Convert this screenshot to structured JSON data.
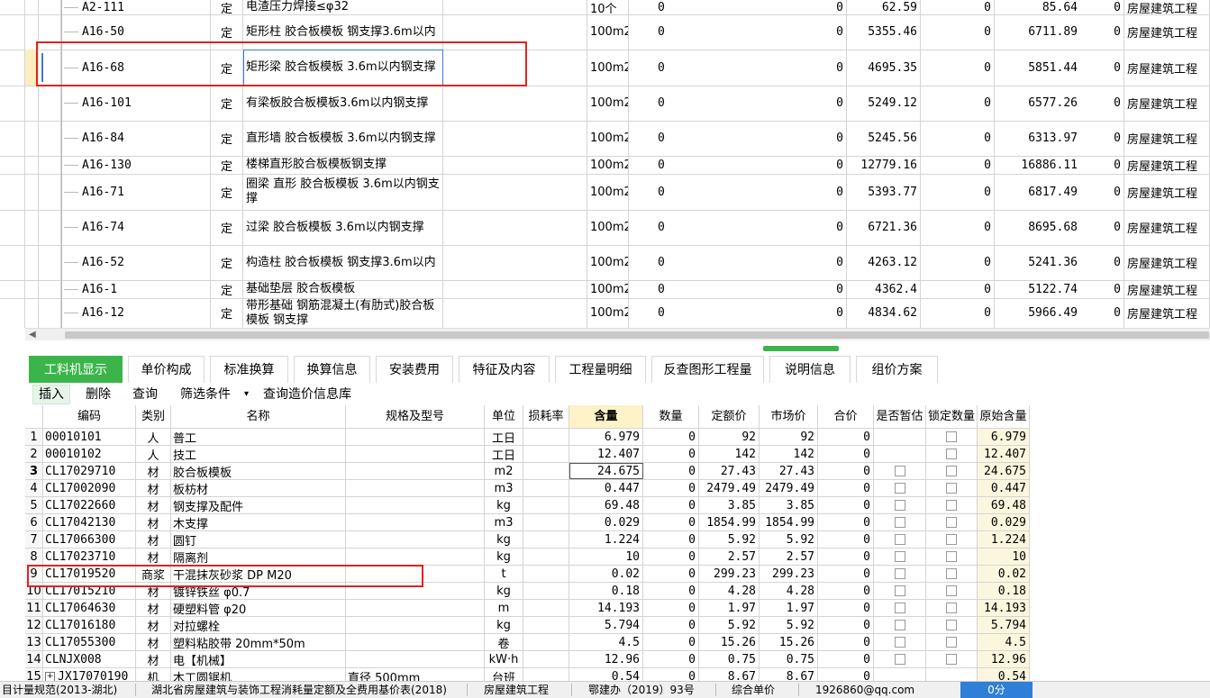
{
  "upper_rows": [
    {
      "code": "A2-111",
      "type": "定",
      "name": "电渣压力焊接≤φ32",
      "unit": "10个",
      "q": "0",
      "p1": "0",
      "v1": "62.59",
      "p2": "0",
      "v2": "85.64",
      "p3": "0",
      "cat": "房屋建筑工程"
    },
    {
      "code": "A16-50",
      "type": "定",
      "name": "矩形柱 胶合板模板 钢支撑3.6m以内",
      "unit": "100m2",
      "q": "0",
      "p1": "0",
      "v1": "5355.46",
      "p2": "0",
      "v2": "6711.89",
      "p3": "0",
      "cat": "房屋建筑工程"
    },
    {
      "code": "A16-68",
      "type": "定",
      "name": "矩形梁 胶合板模板 3.6m以内钢支撑",
      "unit": "100m2",
      "q": "0",
      "p1": "0",
      "v1": "4695.35",
      "p2": "0",
      "v2": "5851.44",
      "p3": "0",
      "cat": "房屋建筑工程"
    },
    {
      "code": "A16-101",
      "type": "定",
      "name": "有梁板胶合板模板3.6m以内钢支撑",
      "unit": "100m2",
      "q": "0",
      "p1": "0",
      "v1": "5249.12",
      "p2": "0",
      "v2": "6577.26",
      "p3": "0",
      "cat": "房屋建筑工程"
    },
    {
      "code": "A16-84",
      "type": "定",
      "name": "直形墙 胶合板模板 3.6m以内钢支撑",
      "unit": "100m2",
      "q": "0",
      "p1": "0",
      "v1": "5245.56",
      "p2": "0",
      "v2": "6313.97",
      "p3": "0",
      "cat": "房屋建筑工程"
    },
    {
      "code": "A16-130",
      "type": "定",
      "name": "楼梯直形胶合板模板钢支撑",
      "unit": "100m2",
      "q": "0",
      "p1": "0",
      "v1": "12779.16",
      "p2": "0",
      "v2": "16886.11",
      "p3": "0",
      "cat": "房屋建筑工程"
    },
    {
      "code": "A16-71",
      "type": "定",
      "name": "圈梁 直形 胶合板模板 3.6m以内钢支撑",
      "unit": "100m2",
      "q": "0",
      "p1": "0",
      "v1": "5393.77",
      "p2": "0",
      "v2": "6817.49",
      "p3": "0",
      "cat": "房屋建筑工程"
    },
    {
      "code": "A16-74",
      "type": "定",
      "name": "过梁 胶合板模板 3.6m以内钢支撑",
      "unit": "100m2",
      "q": "0",
      "p1": "0",
      "v1": "6721.36",
      "p2": "0",
      "v2": "8695.68",
      "p3": "0",
      "cat": "房屋建筑工程"
    },
    {
      "code": "A16-52",
      "type": "定",
      "name": "构造柱 胶合板模板 钢支撑3.6m以内",
      "unit": "100m2",
      "q": "0",
      "p1": "0",
      "v1": "4263.12",
      "p2": "0",
      "v2": "5241.36",
      "p3": "0",
      "cat": "房屋建筑工程"
    },
    {
      "code": "A16-1",
      "type": "定",
      "name": "基础垫层 胶合板模板",
      "unit": "100m2",
      "q": "0",
      "p1": "0",
      "v1": "4362.4",
      "p2": "0",
      "v2": "5122.74",
      "p3": "0",
      "cat": "房屋建筑工程"
    },
    {
      "code": "A16-12",
      "type": "定",
      "name": "带形基础 钢筋混凝土(有肋式)胶合板模板 钢支撑",
      "unit": "100m2",
      "q": "0",
      "p1": "0",
      "v1": "4834.62",
      "p2": "0",
      "v2": "5966.49",
      "p3": "0",
      "cat": "房屋建筑工程"
    }
  ],
  "tabs": [
    "工料机显示",
    "单价构成",
    "标准换算",
    "换算信息",
    "安装费用",
    "特征及内容",
    "工程量明细",
    "反查图形工程量",
    "说明信息",
    "组价方案"
  ],
  "toolbar": {
    "insert": "插入",
    "delete": "删除",
    "query": "查询",
    "filter": "筛选条件",
    "filter_arrow": "▾",
    "price_query": "查询造价信息库"
  },
  "lower_headers": {
    "code": "编码",
    "category": "类别",
    "name": "名称",
    "spec": "规格及型号",
    "unit": "单位",
    "loss": "损耗率",
    "content": "含量",
    "qty": "数量",
    "quota": "定额价",
    "market": "市场价",
    "total": "合价",
    "is_est": "是否暂估",
    "lock_qty": "锁定数量",
    "orig": "原始含量"
  },
  "lower_rows": [
    {
      "no": "1",
      "code": "00010101",
      "cat": "人",
      "name": "普工",
      "spec": "",
      "unit": "工日",
      "content": "6.979",
      "qty": "0",
      "quota": "92",
      "market": "92",
      "total": "0",
      "chk1": false,
      "chk2": true,
      "orig": "6.979"
    },
    {
      "no": "2",
      "code": "00010102",
      "cat": "人",
      "name": "技工",
      "spec": "",
      "unit": "工日",
      "content": "12.407",
      "qty": "0",
      "quota": "142",
      "market": "142",
      "total": "0",
      "chk1": false,
      "chk2": true,
      "orig": "12.407"
    },
    {
      "no": "3",
      "code": "CL17029710",
      "cat": "材",
      "name": "胶合板模板",
      "spec": "",
      "unit": "m2",
      "content": "24.675",
      "qty": "0",
      "quota": "27.43",
      "market": "27.43",
      "total": "0",
      "chk1": true,
      "chk2": true,
      "orig": "24.675"
    },
    {
      "no": "4",
      "code": "CL17002090",
      "cat": "材",
      "name": "板枋材",
      "spec": "",
      "unit": "m3",
      "content": "0.447",
      "qty": "0",
      "quota": "2479.49",
      "market": "2479.49",
      "total": "0",
      "chk1": true,
      "chk2": true,
      "orig": "0.447"
    },
    {
      "no": "5",
      "code": "CL17022660",
      "cat": "材",
      "name": "钢支撑及配件",
      "spec": "",
      "unit": "kg",
      "content": "69.48",
      "qty": "0",
      "quota": "3.85",
      "market": "3.85",
      "total": "0",
      "chk1": true,
      "chk2": true,
      "orig": "69.48"
    },
    {
      "no": "6",
      "code": "CL17042130",
      "cat": "材",
      "name": "木支撑",
      "spec": "",
      "unit": "m3",
      "content": "0.029",
      "qty": "0",
      "quota": "1854.99",
      "market": "1854.99",
      "total": "0",
      "chk1": true,
      "chk2": true,
      "orig": "0.029"
    },
    {
      "no": "7",
      "code": "CL17066300",
      "cat": "材",
      "name": "圆钉",
      "spec": "",
      "unit": "kg",
      "content": "1.224",
      "qty": "0",
      "quota": "5.92",
      "market": "5.92",
      "total": "0",
      "chk1": true,
      "chk2": true,
      "orig": "1.224"
    },
    {
      "no": "8",
      "code": "CL17023710",
      "cat": "材",
      "name": "隔离剂",
      "spec": "",
      "unit": "kg",
      "content": "10",
      "qty": "0",
      "quota": "2.57",
      "market": "2.57",
      "total": "0",
      "chk1": true,
      "chk2": true,
      "orig": "10"
    },
    {
      "no": "9",
      "code": "CL17019520",
      "cat": "商浆",
      "name": "干混抹灰砂浆 DP M20",
      "spec": "",
      "unit": "t",
      "content": "0.02",
      "qty": "0",
      "quota": "299.23",
      "market": "299.23",
      "total": "0",
      "chk1": true,
      "chk2": true,
      "orig": "0.02"
    },
    {
      "no": "10",
      "code": "CL17015210",
      "cat": "材",
      "name": "镀锌铁丝 φ0.7",
      "spec": "",
      "unit": "kg",
      "content": "0.18",
      "qty": "0",
      "quota": "4.28",
      "market": "4.28",
      "total": "0",
      "chk1": true,
      "chk2": true,
      "orig": "0.18"
    },
    {
      "no": "11",
      "code": "CL17064630",
      "cat": "材",
      "name": "硬塑料管 φ20",
      "spec": "",
      "unit": "m",
      "content": "14.193",
      "qty": "0",
      "quota": "1.97",
      "market": "1.97",
      "total": "0",
      "chk1": true,
      "chk2": true,
      "orig": "14.193"
    },
    {
      "no": "12",
      "code": "CL17016180",
      "cat": "材",
      "name": "对拉螺栓",
      "spec": "",
      "unit": "kg",
      "content": "5.794",
      "qty": "0",
      "quota": "5.92",
      "market": "5.92",
      "total": "0",
      "chk1": true,
      "chk2": true,
      "orig": "5.794"
    },
    {
      "no": "13",
      "code": "CL17055300",
      "cat": "材",
      "name": "塑料粘胶带 20mm*50m",
      "spec": "",
      "unit": "卷",
      "content": "4.5",
      "qty": "0",
      "quota": "15.26",
      "market": "15.26",
      "total": "0",
      "chk1": true,
      "chk2": true,
      "orig": "4.5"
    },
    {
      "no": "14",
      "code": "CLNJX008",
      "cat": "材",
      "name": "电【机械】",
      "spec": "",
      "unit": "kW·h",
      "content": "12.96",
      "qty": "0",
      "quota": "0.75",
      "market": "0.75",
      "total": "0",
      "chk1": true,
      "chk2": true,
      "orig": "12.96"
    },
    {
      "no": "15",
      "code": "JX17070190",
      "cat": "机",
      "name": "木工圆锯机",
      "spec": "直径 500mm",
      "unit": "台班",
      "content": "0.54",
      "qty": "0",
      "quota": "8.67",
      "market": "8.67",
      "total": "0",
      "chk1": false,
      "chk2": false,
      "orig": "0.54"
    }
  ],
  "status": {
    "s1": "目计量规范(2013-湖北)",
    "s2": "湖北省房屋建筑与装饰工程消耗量定额及全费用基价表(2018)",
    "s3": "房屋建筑工程",
    "s4": "鄂建办（2019）93号",
    "s5": "综合单价",
    "s6": "1926860@qq.com",
    "s7": "0分"
  },
  "colors": {
    "accent": "#3bb54a",
    "highlight_box": "#e02424",
    "status_button": "#2f7fd8",
    "content_header": "#fdf2c8"
  }
}
